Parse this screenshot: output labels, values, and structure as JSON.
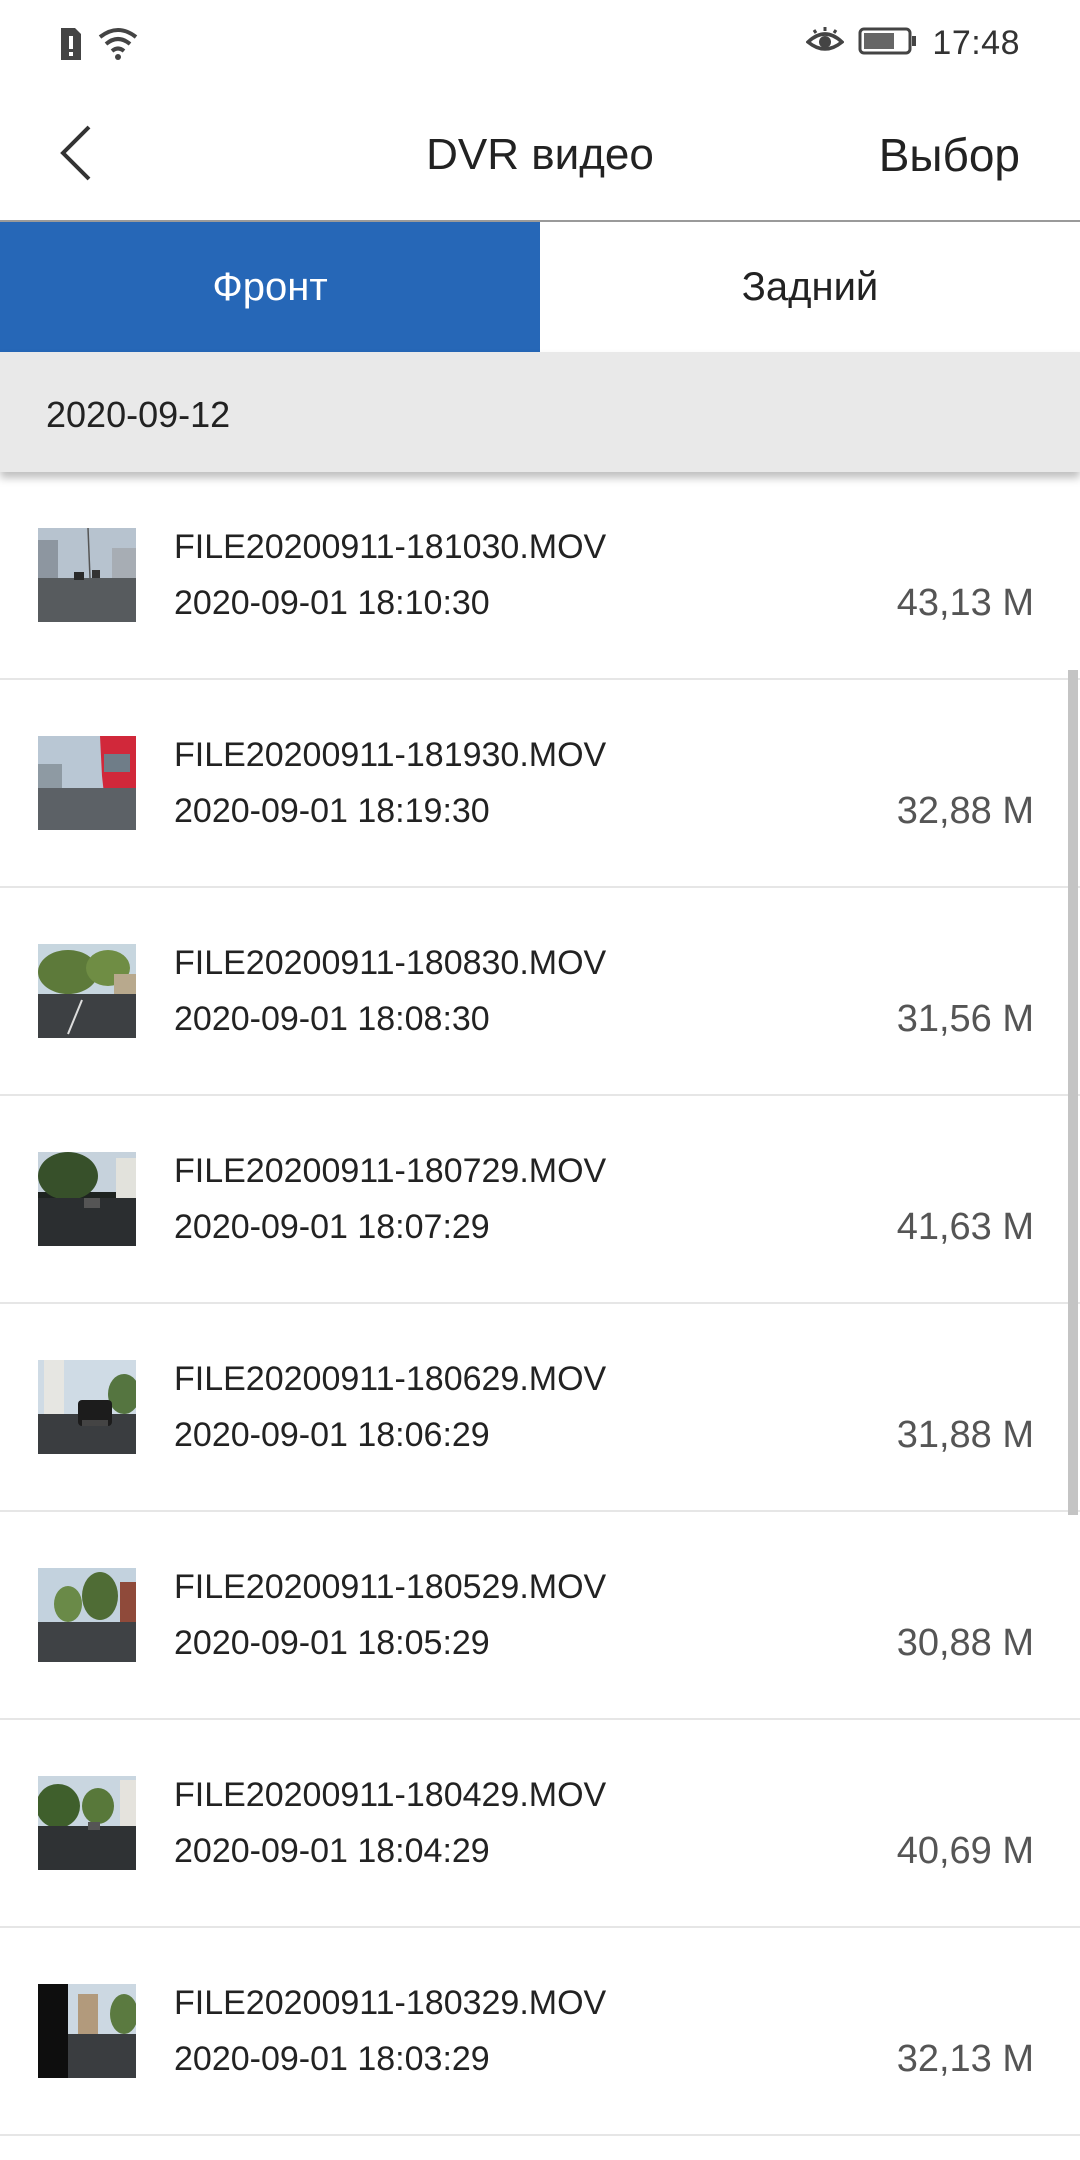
{
  "status_bar": {
    "time": "17:48",
    "icons": [
      "sim-alert-icon",
      "wifi-icon",
      "eye-icon",
      "battery-icon"
    ]
  },
  "header": {
    "title": "DVR видео",
    "select_label": "Выбор",
    "back_icon": "chevron-left-icon"
  },
  "tabs": [
    {
      "label": "Фронт",
      "active": true
    },
    {
      "label": "Задний",
      "active": false
    }
  ],
  "colors": {
    "accent": "#2667b7",
    "group_header_bg": "#e9e9e9"
  },
  "group": {
    "date": "2020-09-12"
  },
  "files": [
    {
      "name": "FILE20200911-181030.MOV",
      "datetime": "2020-09-01 18:10:30",
      "size": "43,13 M"
    },
    {
      "name": "FILE20200911-181930.MOV",
      "datetime": "2020-09-01 18:19:30",
      "size": "32,88 M"
    },
    {
      "name": "FILE20200911-180830.MOV",
      "datetime": "2020-09-01 18:08:30",
      "size": "31,56 M"
    },
    {
      "name": "FILE20200911-180729.MOV",
      "datetime": "2020-09-01 18:07:29",
      "size": "41,63 M"
    },
    {
      "name": "FILE20200911-180629.MOV",
      "datetime": "2020-09-01 18:06:29",
      "size": "31,88 M"
    },
    {
      "name": "FILE20200911-180529.MOV",
      "datetime": "2020-09-01 18:05:29",
      "size": "30,88 M"
    },
    {
      "name": "FILE20200911-180429.MOV",
      "datetime": "2020-09-01 18:04:29",
      "size": "40,69 M"
    },
    {
      "name": "FILE20200911-180329.MOV",
      "datetime": "2020-09-01 18:03:29",
      "size": "32,13 M"
    }
  ]
}
